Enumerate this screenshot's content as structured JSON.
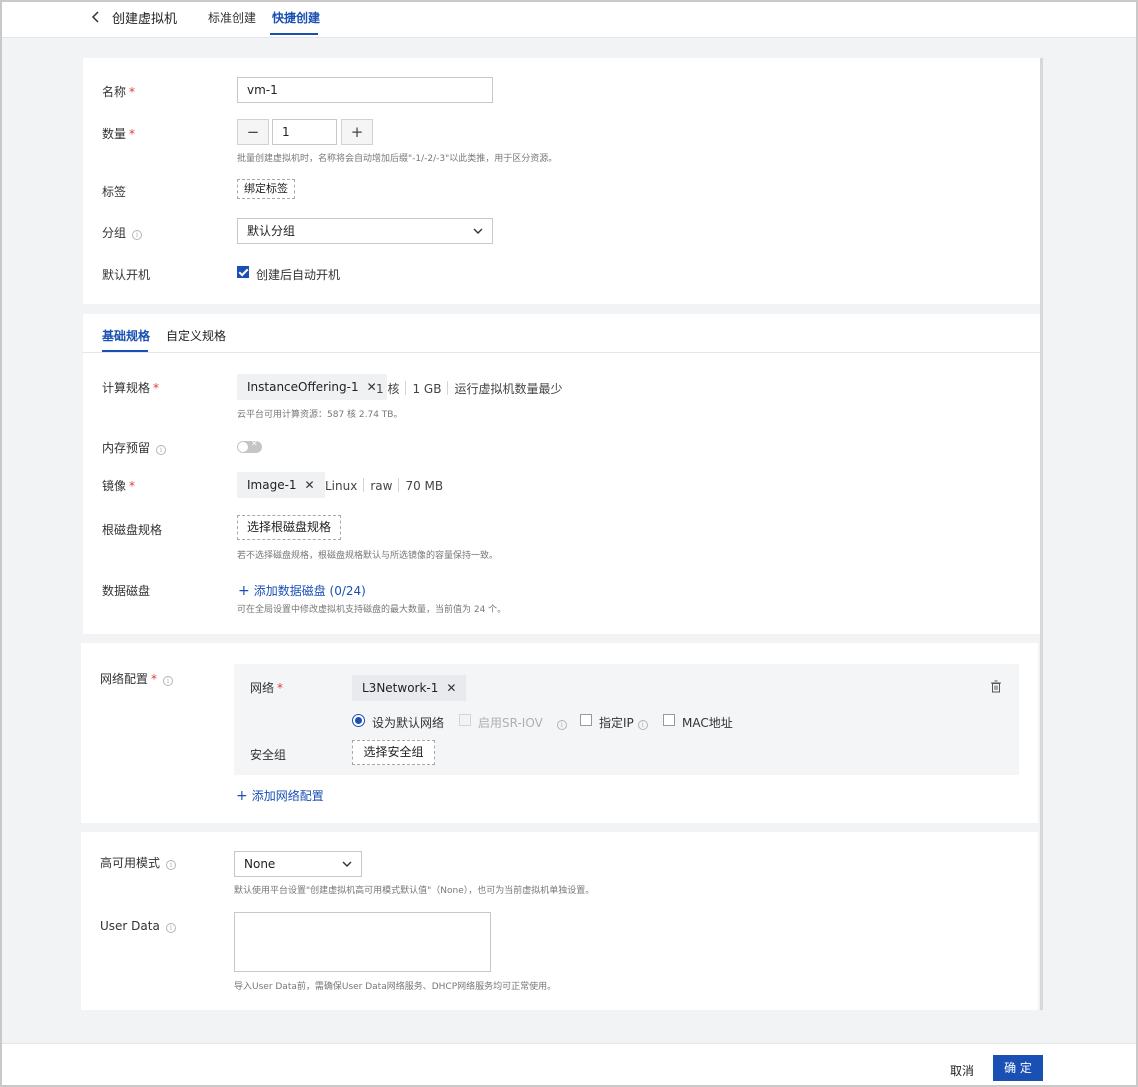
{
  "header": {
    "title": "创建虚拟机",
    "tabs": [
      {
        "label": "标准创建",
        "active": false
      },
      {
        "label": "快捷创建",
        "active": true
      }
    ]
  },
  "basic": {
    "name_label": "名称",
    "name_value": "vm-1",
    "count_label": "数量",
    "count_minus": "−",
    "count_value": "1",
    "count_plus": "+",
    "count_hint": "批量创建虚拟机时，名称将会自动增加后缀\"-1/-2/-3\"以此类推，用于区分资源。",
    "tag_label": "标签",
    "tag_button": "绑定标签",
    "group_label": "分组",
    "group_value": "默认分组",
    "autostart_label": "默认开机",
    "autostart_checked": true,
    "autostart_option": "创建后自动开机"
  },
  "spec": {
    "tabs": [
      {
        "label": "基础规格",
        "active": true
      },
      {
        "label": "自定义规格",
        "active": false
      }
    ],
    "compute_label": "计算规格",
    "compute_chip": "InstanceOffering-1",
    "compute_meta": [
      "1 核",
      "1 GB",
      "运行虚拟机数量最少"
    ],
    "compute_hint": "云平台可用计算资源：587 核 2.74 TB。",
    "memory_reserve_label": "内存预留",
    "memory_reserve_on": false,
    "image_label": "镜像",
    "image_chip": "Image-1",
    "image_meta": [
      "Linux",
      "raw",
      "70 MB"
    ],
    "root_disk_label": "根磁盘规格",
    "root_disk_button": "选择根磁盘规格",
    "root_disk_hint": "若不选择磁盘规格，根磁盘规格默认与所选镜像的容量保持一致。",
    "data_disk_label": "数据磁盘",
    "data_disk_link": "添加数据磁盘 (0/24)",
    "data_disk_hint": "可在全局设置中修改虚拟机支持磁盘的最大数量，当前值为 24 个。"
  },
  "network": {
    "section_label": "网络配置",
    "network_label": "网络",
    "network_chip": "L3Network-1",
    "options": {
      "default_net": "设为默认网络",
      "sriov": "启用SR-IOV",
      "static_ip": "指定IP",
      "mac": "MAC地址"
    },
    "security_group_label": "安全组",
    "security_group_button": "选择安全组",
    "add_link": "添加网络配置"
  },
  "advanced": {
    "ha_label": "高可用模式",
    "ha_value": "None",
    "ha_hint": "默认使用平台设置\"创建虚拟机高可用模式默认值\"（None），也可为当前虚拟机单独设置。",
    "userdata_label": "User Data",
    "userdata_value": "",
    "userdata_hint": "导入User Data前，需确保User Data网络服务、DHCP网络服务均可正常使用。"
  },
  "footer": {
    "cancel": "取消",
    "ok": "确 定"
  },
  "colors": {
    "accent": "#1a4fb3",
    "required": "#e23b3b"
  }
}
